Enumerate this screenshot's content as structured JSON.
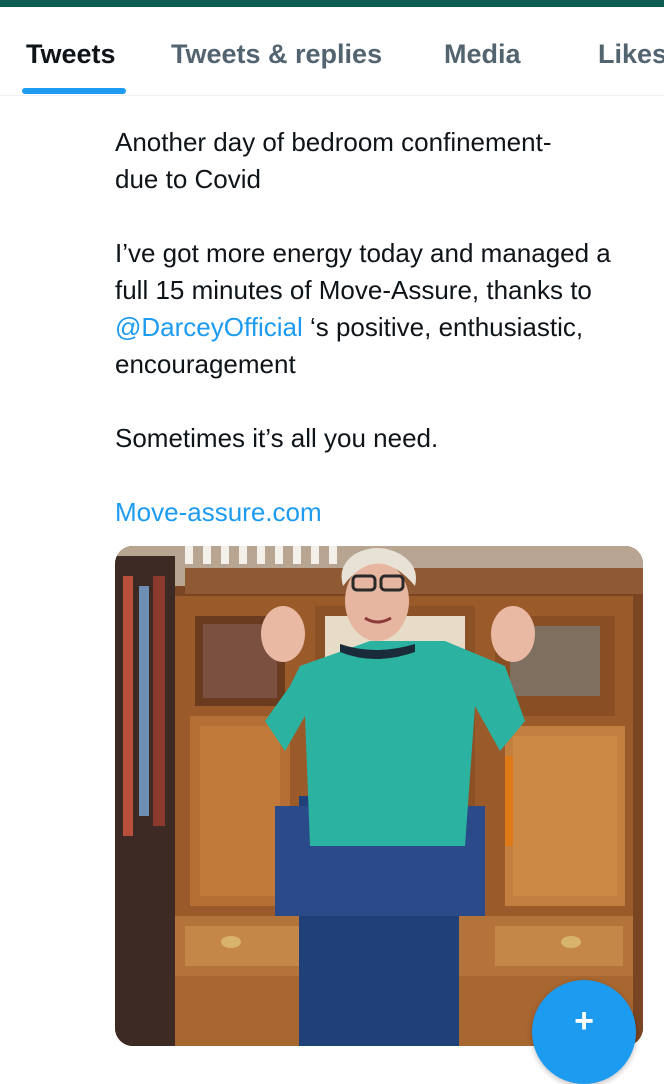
{
  "tabs": [
    {
      "label": "Tweets",
      "active": true
    },
    {
      "label": "Tweets & replies",
      "active": false
    },
    {
      "label": "Media",
      "active": false
    },
    {
      "label": "Likes",
      "active": false
    }
  ],
  "tweet": {
    "line1": "Another day of bedroom confinement-",
    "line2": "due to Covid",
    "para2_before": "I’ve got more energy today and managed a full 15 minutes of Move-Assure, thanks to ",
    "mention": "@DarceyOfficial",
    "para2_after": " ‘s positive, enthusiastic, encouragement",
    "para3": "Sometimes it’s all you need.",
    "link": "Move-assure.com"
  },
  "media": {
    "kind": "video",
    "icon": "video-thumbnail"
  },
  "fab": {
    "icon": "compose-plus-icon",
    "symbol": "+"
  },
  "colors": {
    "accent": "#1d9bf0",
    "topbar": "#0d5c53",
    "text": "#0f1419",
    "muted": "#536471"
  }
}
